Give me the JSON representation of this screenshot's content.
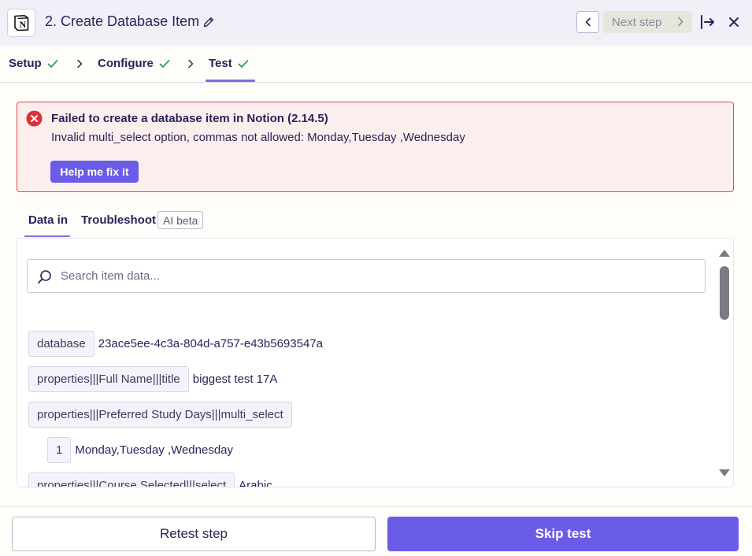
{
  "header": {
    "app_icon_letter": "N",
    "title": "2. Create Database Item",
    "next_label": "Next step"
  },
  "stepper": {
    "steps": [
      {
        "label": "Setup"
      },
      {
        "label": "Configure"
      },
      {
        "label": "Test"
      }
    ]
  },
  "alert": {
    "title": "Failed to create a database item in Notion (2.14.5)",
    "message": "Invalid multi_select option, commas not allowed: Monday,Tuesday ,Wednesday",
    "fix_label": "Help me fix it"
  },
  "tabs": {
    "data_in": "Data in",
    "troubleshoot": "Troubleshoot",
    "beta": "AI beta"
  },
  "data_panel": {
    "search_placeholder": "Search item data...",
    "rows": [
      {
        "key": "database",
        "value": "23ace5ee-4c3a-804d-a757-e43b5693547a"
      },
      {
        "key": "properties|||Full Name|||title",
        "value": "biggest test 17A"
      },
      {
        "key": "properties|||Preferred Study Days|||multi_select",
        "value": ""
      },
      {
        "key": "1",
        "value": "Monday,Tuesday ,Wednesday"
      },
      {
        "key": "properties|||Course Selected|||select",
        "value": "Arabic"
      }
    ]
  },
  "footer": {
    "retest_label": "Retest step",
    "skip_label": "Skip test"
  },
  "colors": {
    "accent": "#6b5ce7",
    "error": "#e2484f",
    "success": "#2e9e55"
  }
}
